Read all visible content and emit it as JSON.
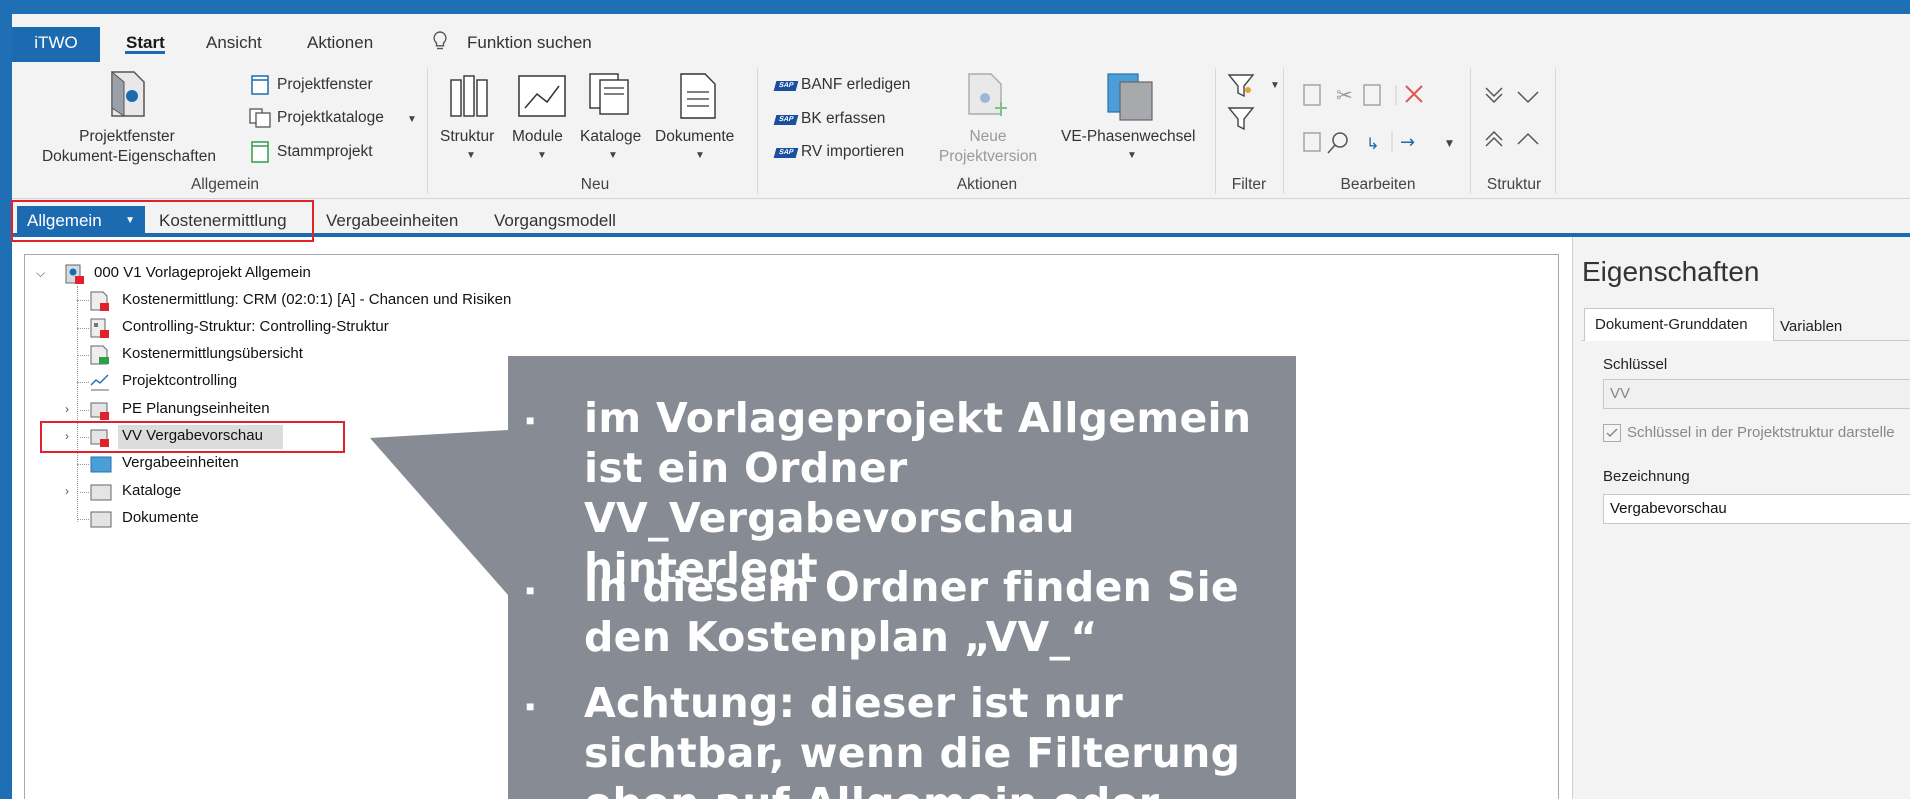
{
  "menu": {
    "itwo": "iTWO",
    "tabs": [
      "Start",
      "Ansicht",
      "Aktionen"
    ],
    "search": "Funktion suchen"
  },
  "ribbon": {
    "allgemein": {
      "projektfenster_doc_line1": "Projektfenster",
      "projektfenster_doc_line2": "Dokument-Eigenschaften",
      "projektfenster": "Projektfenster",
      "projektkataloge": "Projektkataloge",
      "stammprojekt": "Stammprojekt",
      "label": "Allgemein"
    },
    "neu": {
      "items": [
        "Struktur",
        "Module",
        "Kataloge",
        "Dokumente"
      ],
      "label": "Neu"
    },
    "aktionen": {
      "banf": "BANF erledigen",
      "bk": "BK erfassen",
      "rv": "RV importieren",
      "neue_line1": "Neue",
      "neue_line2": "Projektversion",
      "ve": "VE-Phasenwechsel",
      "label": "Aktionen"
    },
    "filter_label": "Filter",
    "bearbeiten_label": "Bearbeiten",
    "struktur_label": "Struktur"
  },
  "context_tabs": {
    "active": "Allgemein",
    "items": [
      "Kostenermittlung",
      "Vergabeeinheiten",
      "Vorgangsmodell"
    ]
  },
  "tree": {
    "root": "000 V1 Vorlageprojekt Allgemein",
    "items": [
      "Kostenermittlung: CRM (02:0:1) [A]  - Chancen und Risiken",
      "Controlling-Struktur: Controlling-Struktur",
      "Kostenermittlungsübersicht",
      "Projektcontrolling",
      "PE Planungseinheiten",
      "VV Vergabevorschau",
      "Vergabeeinheiten",
      "Kataloge",
      "Dokumente"
    ]
  },
  "callout": {
    "bullets": [
      "im Vorlageprojekt Allgemein ist ein Ordner VV_Vergabevorschau hinterlegt",
      "in diesem Ordner finden Sie den Kostenplan „VV_“",
      "Achtung: dieser ist nur sichtbar, wenn die Filterung oben auf Allgemein oder"
    ]
  },
  "properties": {
    "title": "Eigenschaften",
    "tabs": [
      "Dokument-Grunddaten",
      "Variablen"
    ],
    "schluessel_label": "Schlüssel",
    "schluessel_value": "VV",
    "checkbox_label": "Schlüssel in der Projektstruktur darstelle",
    "bezeichnung_label": "Bezeichnung",
    "bezeichnung_value": "Vergabevorschau"
  },
  "colors": {
    "accent": "#1c6ab0",
    "highlight_box": "#e0222c",
    "callout_bg": "#878b94"
  }
}
